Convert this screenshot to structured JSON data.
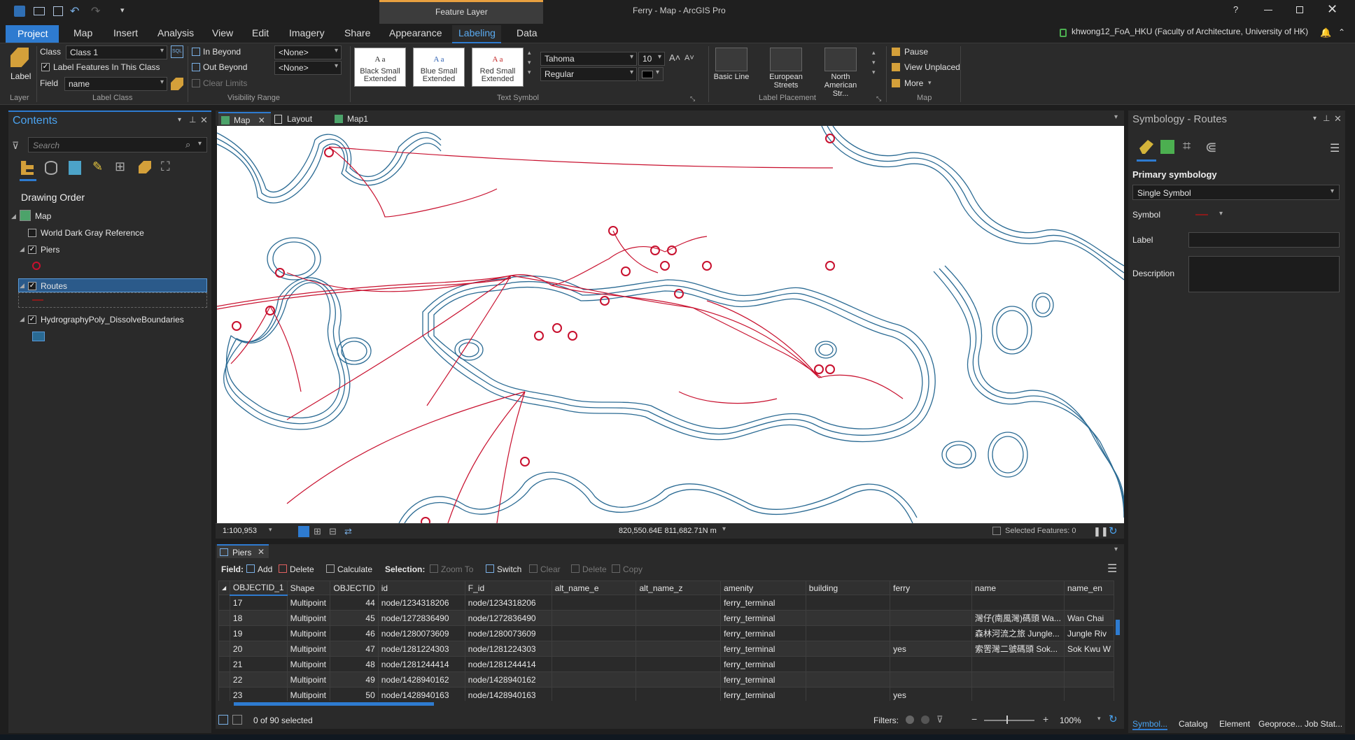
{
  "window": {
    "title": "Ferry - Map - ArcGIS Pro",
    "context_tab": "Feature Layer",
    "help": "?",
    "user": "khwong12_FoA_HKU (Faculty of Architecture, University of HK)"
  },
  "ribbon_tabs": [
    "Project",
    "Map",
    "Insert",
    "Analysis",
    "View",
    "Edit",
    "Imagery",
    "Share",
    "Appearance",
    "Labeling",
    "Data"
  ],
  "ribbon": {
    "layer": {
      "label_button": "Label",
      "group": "Layer"
    },
    "label_class": {
      "class_label": "Class",
      "class_value": "Class 1",
      "label_features": "Label Features In This Class",
      "field_label": "Field",
      "field_value": "name",
      "sql": "SQL",
      "group": "Label Class"
    },
    "visibility": {
      "in_beyond": "In Beyond",
      "in_beyond_value": "<None>",
      "out_beyond": "Out Beyond",
      "out_beyond_value": "<None>",
      "clear_limits": "Clear Limits",
      "group": "Visibility Range"
    },
    "text_symbol": {
      "gallery": [
        {
          "sample": "A a",
          "name": "Black Small Extended",
          "color": "#222222"
        },
        {
          "sample": "A a",
          "name": "Blue Small Extended",
          "color": "#2a5db0"
        },
        {
          "sample": "A a",
          "name": "Red Small Extended",
          "color": "#c02020"
        }
      ],
      "font": "Tahoma",
      "size": "10",
      "style": "Regular",
      "group": "Text Symbol"
    },
    "label_placement": {
      "items": [
        "Basic Line",
        "European Streets",
        "North American Str..."
      ],
      "group": "Label Placement"
    },
    "map": {
      "pause": "Pause",
      "view_unplaced": "View Unplaced",
      "more": "More",
      "group": "Map"
    }
  },
  "contents": {
    "title": "Contents",
    "search_placeholder": "Search",
    "drawing_order": "Drawing Order",
    "layers": [
      {
        "name": "Map",
        "checked": null
      },
      {
        "name": "World Dark Gray Reference",
        "checked": false
      },
      {
        "name": "Piers",
        "checked": true
      },
      {
        "name": "Routes",
        "checked": true
      },
      {
        "name": "HydrographyPoly_DissolveBoundaries",
        "checked": true
      }
    ]
  },
  "map_tabs": [
    "Map",
    "Layout",
    "Map1"
  ],
  "map_status": {
    "scale": "1:100,953",
    "coords": "820,550.64E 811,682.71N m",
    "selected": "Selected Features: 0"
  },
  "colors": {
    "accent": "#2e7bd0",
    "route": "#c8102e",
    "coast": "#2a6a93"
  },
  "table": {
    "tab": "Piers",
    "field_label": "Field:",
    "add": "Add",
    "delete": "Delete",
    "calculate": "Calculate",
    "selection_label": "Selection:",
    "zoom_to": "Zoom To",
    "switch": "Switch",
    "clear": "Clear",
    "delete2": "Delete",
    "copy": "Copy",
    "columns": [
      "OBJECTID_1",
      "Shape",
      "OBJECTID",
      "id",
      "F_id",
      "alt_name_e",
      "alt_name_z",
      "amenity",
      "building",
      "ferry",
      "name",
      "name_en"
    ],
    "rows": [
      [
        "17",
        "Multipoint",
        "44",
        "node/1234318206",
        "node/1234318206",
        "",
        "",
        "ferry_terminal",
        "",
        "",
        "",
        ""
      ],
      [
        "18",
        "Multipoint",
        "45",
        "node/1272836490",
        "node/1272836490",
        "",
        "",
        "ferry_terminal",
        "",
        "",
        "灣仔(南風灣)碼頭 Wa...",
        "Wan Chai"
      ],
      [
        "19",
        "Multipoint",
        "46",
        "node/1280073609",
        "node/1280073609",
        "",
        "",
        "ferry_terminal",
        "",
        "",
        "森林河流之旅 Jungle...",
        "Jungle Riv"
      ],
      [
        "20",
        "Multipoint",
        "47",
        "node/1281224303",
        "node/1281224303",
        "",
        "",
        "ferry_terminal",
        "",
        "yes",
        "索罟灣二號碼頭 Sok...",
        "Sok Kwu W"
      ],
      [
        "21",
        "Multipoint",
        "48",
        "node/1281244414",
        "node/1281244414",
        "",
        "",
        "ferry_terminal",
        "",
        "",
        "",
        ""
      ],
      [
        "22",
        "Multipoint",
        "49",
        "node/1428940162",
        "node/1428940162",
        "",
        "",
        "ferry_terminal",
        "",
        "",
        "",
        ""
      ],
      [
        "23",
        "Multipoint",
        "50",
        "node/1428940163",
        "node/1428940163",
        "",
        "",
        "ferry_terminal",
        "",
        "yes",
        "",
        ""
      ]
    ],
    "selected_text": "0 of 90 selected",
    "filters": "Filters:",
    "zoom": "100%"
  },
  "symbology": {
    "title": "Symbology - Routes",
    "primary": "Primary symbology",
    "type": "Single Symbol",
    "symbol_label": "Symbol",
    "label_label": "Label",
    "description_label": "Description"
  },
  "bottom_tabs": [
    "Symbol...",
    "Catalog",
    "Element",
    "Geoproce...",
    "Job Stat..."
  ]
}
